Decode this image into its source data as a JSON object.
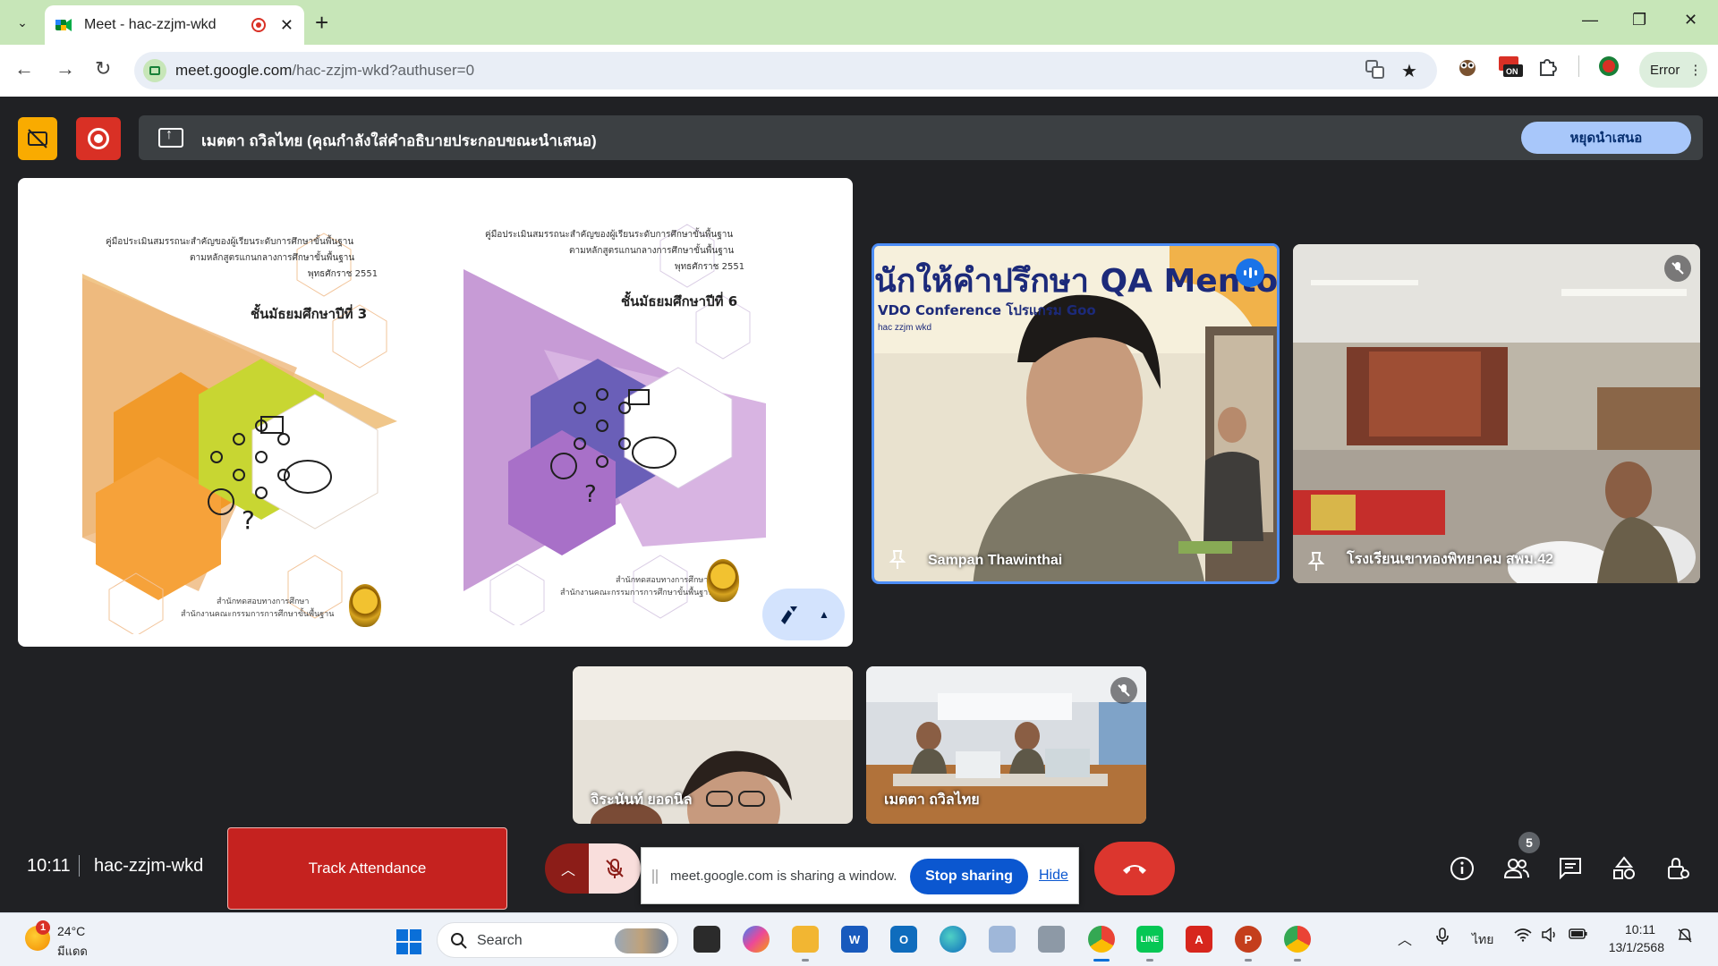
{
  "browser": {
    "tab_title": "Meet - hac-zzjm-wkd",
    "tab_close": "✕",
    "new_tab": "+",
    "url_host": "meet.google.com",
    "url_path": "/hac-zzjm-wkd?authuser=0",
    "profile_status": "Error",
    "window_controls": [
      "—",
      "❐",
      "✕"
    ]
  },
  "meet": {
    "presenting_text": "เมตตา ถวิลไทย (คุณกำลังใส่คำอธิบายประกอบขณะนำเสนอ)",
    "stop_presenting": "หยุดนำเสนอ",
    "time": "10:11",
    "meeting_code": "hac-zzjm-wkd",
    "track_attendance": "Track Attendance",
    "share_message": "meet.google.com is sharing a window.",
    "stop_sharing": "Stop sharing",
    "hide": "Hide",
    "participant_count": "5"
  },
  "shared_screen": {
    "books": [
      {
        "title_line1": "คู่มือประเมินสมรรถนะสำคัญของผู้เรียนระดับการศึกษาขั้นพื้นฐาน",
        "title_line2": "ตามหลักสูตรแกนกลางการศึกษาขั้นพื้นฐาน",
        "title_line3": "พุทธศักราช 2551",
        "grade": "ชั้นมัธยมศึกษาปีที่ 3",
        "publisher1": "สำนักทดสอบทางการศึกษา",
        "publisher2": "สำนักงานคณะกรรมการการศึกษาขั้นพื้นฐาน"
      },
      {
        "title_line1": "คู่มือประเมินสมรรถนะสำคัญของผู้เรียนระดับการศึกษาขั้นพื้นฐาน",
        "title_line2": "ตามหลักสูตรแกนกลางการศึกษาขั้นพื้นฐาน",
        "title_line3": "พุทธศักราช 2551",
        "grade": "ชั้นมัธยมศึกษาปีที่ 6",
        "publisher1": "สำนักทดสอบทางการศึกษา",
        "publisher2": "สำนักงานคณะกรรมการการศึกษาขั้นพื้นฐาน"
      }
    ]
  },
  "participants": [
    {
      "name": "Sampan Thawinthai",
      "speaking": true,
      "banner_title": "นักให้คำปรึกษา QA Mentor",
      "banner_sub": "VDO Conference โปรแกรม Goo",
      "banner_code": "hac zzjm wkd"
    },
    {
      "name": "โรงเรียนเขาทองพิทยาคม สพม.42",
      "muted": true
    },
    {
      "name": "จิระนันท์ ยอดนิล"
    },
    {
      "name": "เมตตา ถวิลไทย",
      "muted": true
    }
  ],
  "taskbar": {
    "temperature": "24°C",
    "condition": "มีแดด",
    "weather_badge": "1",
    "search_label": "Search",
    "language": "ไทย",
    "clock_time": "10:11",
    "clock_date": "13/1/2568"
  },
  "colors": {
    "meet_bg": "#202124",
    "accent_blue": "#0b57d0",
    "hangup_red": "#dc362e",
    "tab_strip_green": "#c7e6b8"
  }
}
